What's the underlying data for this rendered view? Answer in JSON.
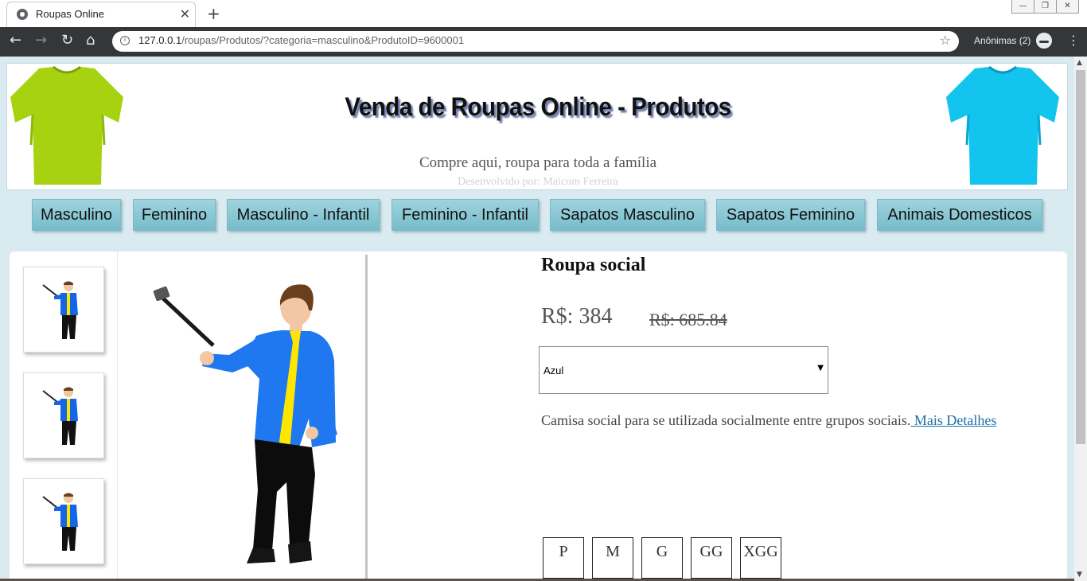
{
  "browser": {
    "tab_title": "Roupas Online",
    "tab_close": "✕",
    "new_tab": "+",
    "url_host": "127.0.0.1",
    "url_rest": "/roupas/Produtos/?categoria=masculino&ProdutoID=9600001",
    "incognito_label": "Anônimas (2)",
    "window_controls": [
      "—",
      "❐",
      "✕"
    ]
  },
  "header": {
    "title": "Venda de Roupas Online - Produtos",
    "tagline": "Compre aqui, roupa para toda a família",
    "credit": "Desenvolvido por: Maicom Ferreira",
    "left_shirt_color": "#a6d20f",
    "right_shirt_color": "#12c4ee"
  },
  "categories": [
    "Masculino",
    "Feminino",
    "Masculino - Infantil",
    "Feminino - Infantil",
    "Sapatos Masculino",
    "Sapatos Feminino",
    "Animais Domesticos"
  ],
  "product": {
    "name": "Roupa social",
    "price": "R$: 384",
    "old_price": "R$: 685.84",
    "color_selected": "Azul",
    "description": "Camisa social para se utilizada socialmente entre grupos sociais.",
    "details_link": " Mais Detalhes",
    "sizes": [
      "P",
      "M",
      "G",
      "GG",
      "XGG"
    ],
    "thumbnail_count": 3
  }
}
